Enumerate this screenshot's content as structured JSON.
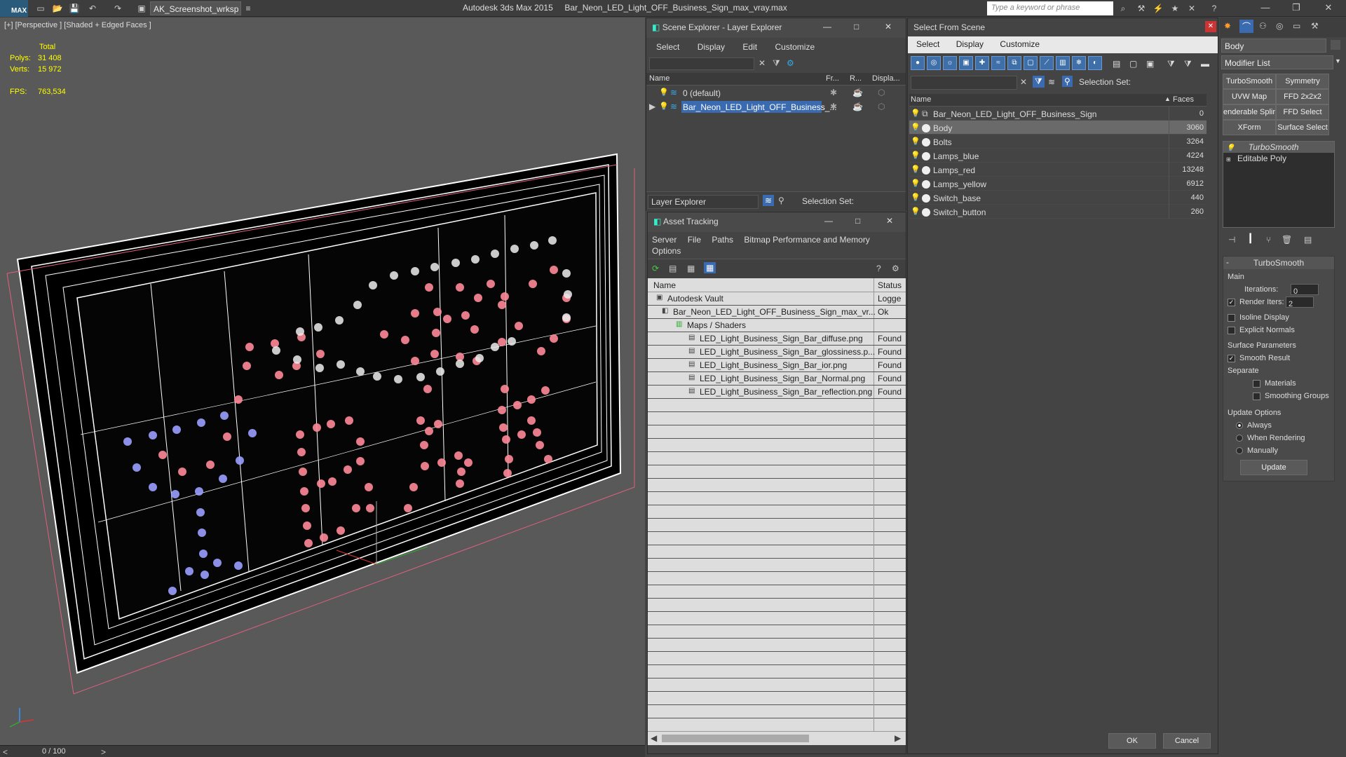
{
  "titlebar": {
    "logo": "MAX",
    "workspace": "AK_Screenshot_wrksp",
    "app_name": "Autodesk 3ds Max  2015",
    "file_name": "Bar_Neon_LED_Light_OFF_Business_Sign_max_vray.max",
    "search_placeholder": "Type a keyword or phrase"
  },
  "viewport": {
    "label": "[+] [Perspective ] [Shaded + Edged Faces ]",
    "stats": {
      "total_label": "Total",
      "polys_label": "Polys:",
      "polys_value": "31 408",
      "verts_label": "Verts:",
      "verts_value": "15 972",
      "fps_label": "FPS:",
      "fps_value": "763,534"
    },
    "timeline": "0 / 100"
  },
  "scene_explorer": {
    "title": "Scene Explorer - Layer Explorer",
    "menu": [
      "Select",
      "Display",
      "Edit",
      "Customize"
    ],
    "columns": [
      "Name",
      "Fr...",
      "R...",
      "Displa..."
    ],
    "rows": [
      {
        "name": "0 (default)"
      },
      {
        "name": "Bar_Neon_LED_Light_OFF_Business_..."
      }
    ],
    "footer_label": "Layer Explorer",
    "selection_set": "Selection Set:"
  },
  "asset_tracking": {
    "title": "Asset Tracking",
    "menu": [
      "Server",
      "File",
      "Paths",
      "Bitmap Performance and Memory"
    ],
    "menu2": "Options",
    "columns": [
      "Name",
      "Status"
    ],
    "rows": [
      {
        "name": "Autodesk Vault",
        "status": "Logge"
      },
      {
        "name": "Bar_Neon_LED_Light_OFF_Business_Sign_max_vr...",
        "status": "Ok"
      },
      {
        "name": "Maps / Shaders",
        "status": ""
      },
      {
        "name": "LED_Light_Business_Sign_Bar_diffuse.png",
        "status": "Found"
      },
      {
        "name": "LED_Light_Business_Sign_Bar_glossiness.p...",
        "status": "Found"
      },
      {
        "name": "LED_Light_Business_Sign_Bar_ior.png",
        "status": "Found"
      },
      {
        "name": "LED_Light_Business_Sign_Bar_Normal.png",
        "status": "Found"
      },
      {
        "name": "LED_Light_Business_Sign_Bar_reflection.png",
        "status": "Found"
      }
    ]
  },
  "select_from_scene": {
    "title": "Select From Scene",
    "menu": [
      "Select",
      "Display",
      "Customize"
    ],
    "selection_set": "Selection Set:",
    "columns": [
      "Name",
      "Faces"
    ],
    "rows": [
      {
        "name": "Bar_Neon_LED_Light_OFF_Business_Sign",
        "faces": "0"
      },
      {
        "name": "Body",
        "faces": "3060"
      },
      {
        "name": "Bolts",
        "faces": "3264"
      },
      {
        "name": "Lamps_blue",
        "faces": "4224"
      },
      {
        "name": "Lamps_red",
        "faces": "13248"
      },
      {
        "name": "Lamps_yellow",
        "faces": "6912"
      },
      {
        "name": "Switch_base",
        "faces": "440"
      },
      {
        "name": "Switch_button",
        "faces": "260"
      }
    ],
    "ok": "OK",
    "cancel": "Cancel"
  },
  "command_panel": {
    "object_name": "Body",
    "modifier_list": "Modifier List",
    "modifier_buttons": [
      "TurboSmooth",
      "Symmetry",
      "UVW Map",
      "FFD 2x2x2",
      "enderable Splir",
      "FFD Select",
      "XForm",
      "Surface Select"
    ],
    "stack": [
      "TurboSmooth",
      "Editable Poly"
    ],
    "rollout_title": "TurboSmooth",
    "main_label": "Main",
    "iterations_label": "Iterations:",
    "iterations_value": "0",
    "render_iters_label": "Render Iters:",
    "render_iters_value": "2",
    "isoline": "Isoline Display",
    "explicit_normals": "Explicit Normals",
    "surface_params": "Surface Parameters",
    "smooth_result": "Smooth Result",
    "separate": "Separate",
    "materials": "Materials",
    "smoothing_groups": "Smoothing Groups",
    "update_options": "Update Options",
    "always": "Always",
    "when_rendering": "When Rendering",
    "manually": "Manually",
    "update_btn": "Update"
  }
}
